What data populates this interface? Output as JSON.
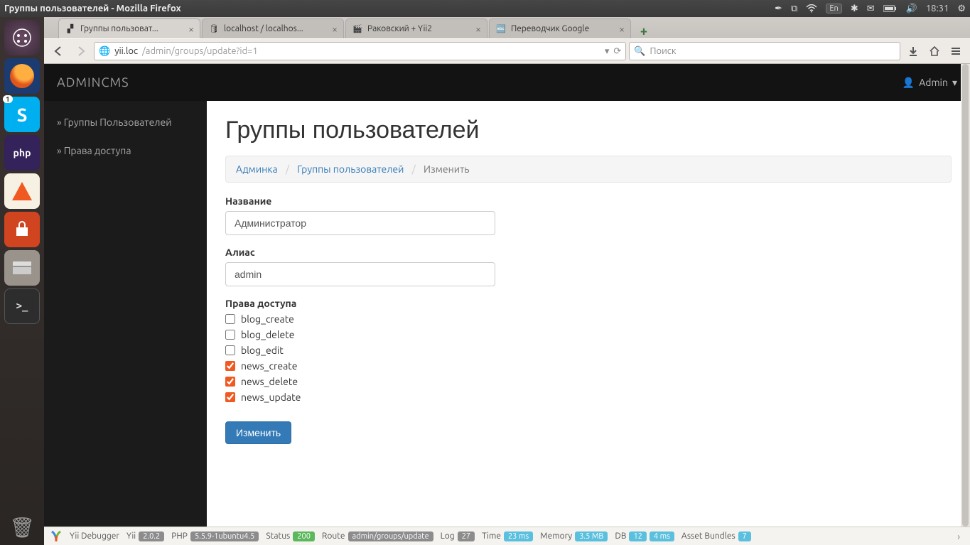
{
  "os": {
    "window_title": "Группы пользователей - Mozilla Firefox",
    "lang": "En",
    "time": "18:31"
  },
  "launcher": {
    "skype_badge": "1"
  },
  "browser": {
    "tabs": [
      {
        "label": "Группы пользоват...",
        "active": true
      },
      {
        "label": "localhost / localhos...",
        "active": false
      },
      {
        "label": "Раковский + Yii2",
        "active": false
      },
      {
        "label": "Переводчик Google",
        "active": false
      }
    ],
    "url_host": "yii.loc",
    "url_path": "/admin/groups/update?id=1",
    "search_placeholder": "Поиск"
  },
  "app": {
    "brand": "ADMINCMS",
    "user": "Admin",
    "side_nav": [
      "» Группы Пользователей",
      "» Права доступа"
    ],
    "page_title": "Группы пользователей",
    "breadcrumb": {
      "items": [
        "Админка",
        "Группы пользователей"
      ],
      "active": "Изменить"
    },
    "form": {
      "name_label": "Название",
      "name_value": "Администратор",
      "alias_label": "Алиас",
      "alias_value": "admin",
      "perm_label": "Права доступа",
      "permissions": [
        {
          "label": "blog_create",
          "checked": false
        },
        {
          "label": "blog_delete",
          "checked": false
        },
        {
          "label": "blog_edit",
          "checked": false
        },
        {
          "label": "news_create",
          "checked": true
        },
        {
          "label": "news_delete",
          "checked": true
        },
        {
          "label": "news_update",
          "checked": true
        }
      ],
      "submit": "Изменить"
    }
  },
  "debug": {
    "title": "Yii Debugger",
    "yii_label": "Yii",
    "yii": "2.0.2",
    "php_label": "PHP",
    "php": "5.5.9-1ubuntu4.5",
    "status_label": "Status",
    "status": "200",
    "route_label": "Route",
    "route": "admin/groups/update",
    "log_label": "Log",
    "log": "27",
    "time_label": "Time",
    "time": "23 ms",
    "mem_label": "Memory",
    "mem": "3.5 MB",
    "db_label": "DB",
    "db_q": "12",
    "db_t": "4 ms",
    "assets_label": "Asset Bundles",
    "assets": "7"
  }
}
